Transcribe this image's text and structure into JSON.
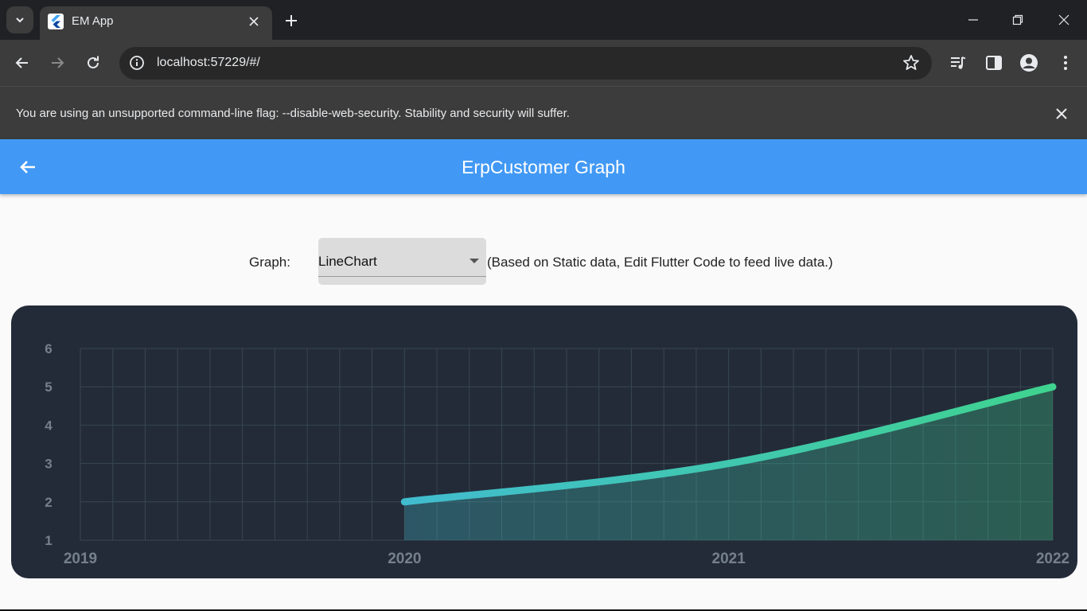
{
  "browser": {
    "tab_title": "EM App",
    "url": "localhost:57229/#/"
  },
  "infobar": {
    "message": "You are using an unsupported command-line flag: --disable-web-security. Stability and security will suffer."
  },
  "app": {
    "title": "ErpCustomer Graph",
    "graph_label": "Graph:",
    "dropdown_value": "LineChart",
    "note": "(Based on Static data, Edit Flutter Code to feed live data.)"
  },
  "colors": {
    "app_bar": "#4299f5",
    "chart_bg": "#232b38",
    "line_start": "#41bccf",
    "line_end": "#3fd38f"
  },
  "chart_data": {
    "type": "area",
    "x_tick_labels": [
      "2019",
      "2020",
      "2021",
      "2022"
    ],
    "y_tick_labels": [
      "1",
      "2",
      "3",
      "4",
      "5",
      "6"
    ],
    "xlim": [
      2019,
      2022
    ],
    "ylim": [
      1,
      6
    ],
    "grid": true,
    "series": [
      {
        "points": [
          [
            2020,
            2
          ],
          [
            2021,
            3
          ],
          [
            2022,
            5
          ]
        ]
      }
    ]
  }
}
